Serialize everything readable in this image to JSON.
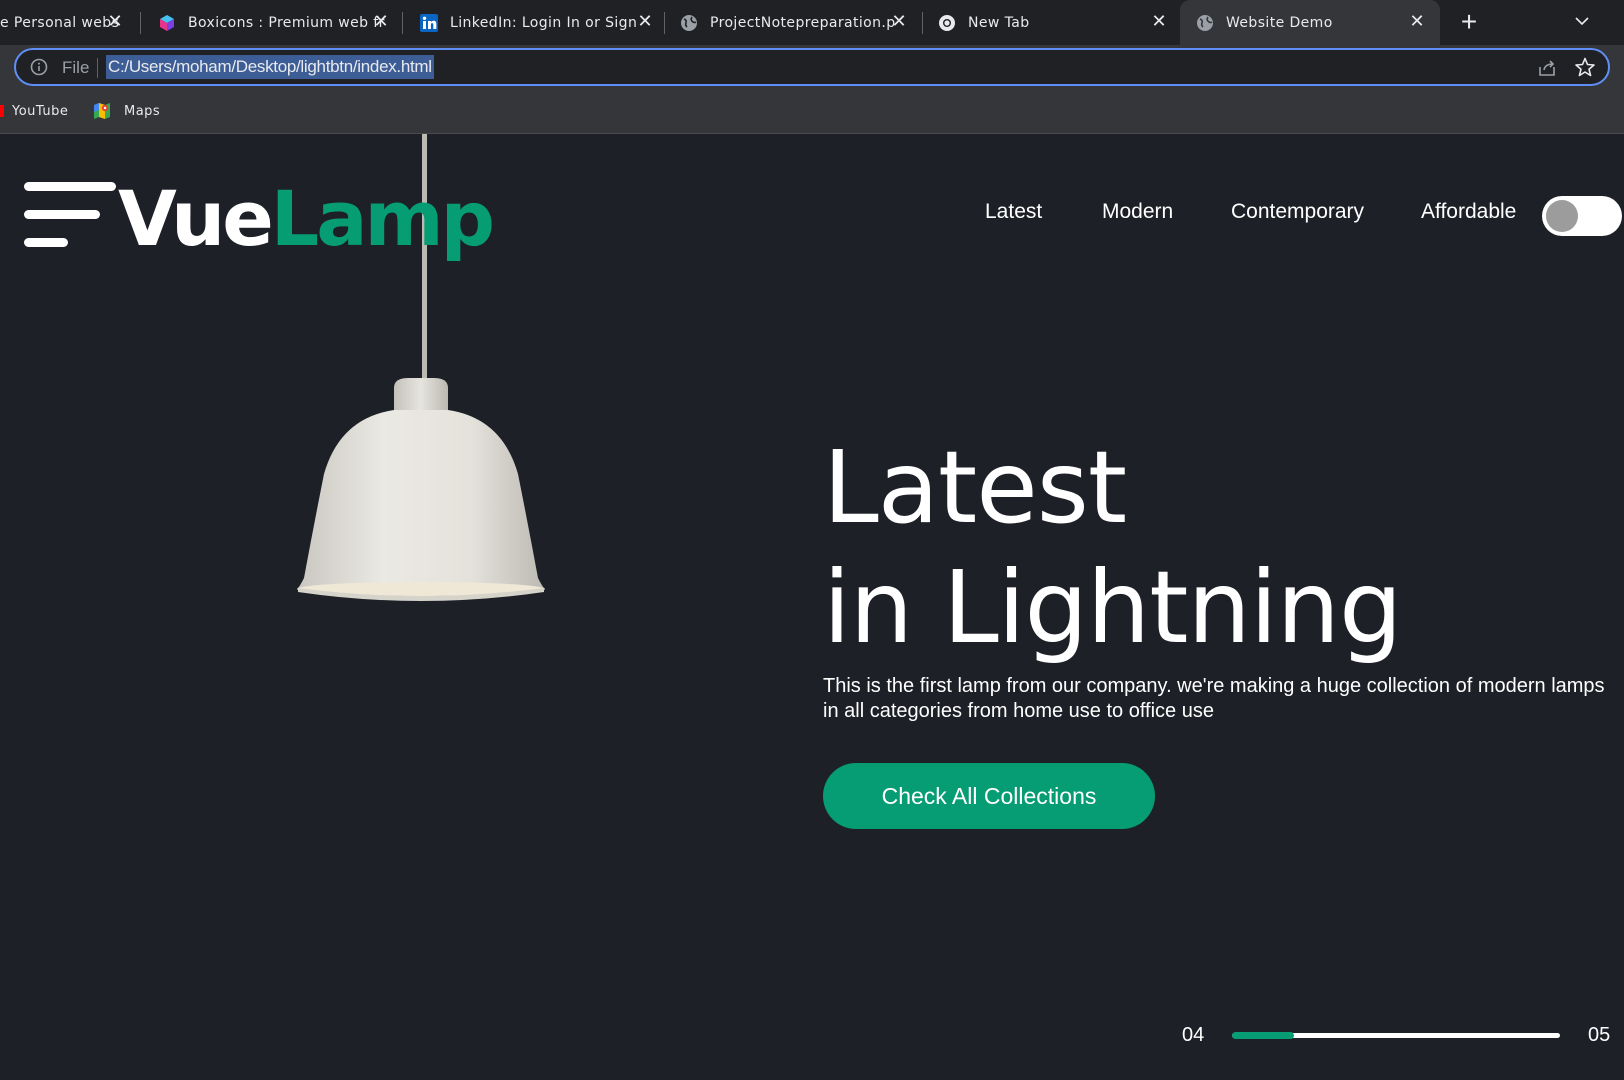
{
  "browser": {
    "tabs": [
      {
        "label": "e Personal webs",
        "icon": "globe-icon",
        "active": false
      },
      {
        "label": "Boxicons : Premium web fr",
        "icon": "boxicons-icon",
        "active": false
      },
      {
        "label": "LinkedIn: Login In or Sign",
        "icon": "linkedin-icon",
        "active": false
      },
      {
        "label": "ProjectNotepreparation.p",
        "icon": "globe-icon",
        "active": false
      },
      {
        "label": "New Tab",
        "icon": "chrome-icon",
        "active": false
      },
      {
        "label": "Website Demo",
        "icon": "globe-icon",
        "active": true
      }
    ],
    "new_tab_glyph": "+",
    "close_glyph": "✕",
    "address": {
      "scheme_label": "File",
      "url": "C:/Users/moham/Desktop/lightbtn/index.html"
    },
    "bookmarks": [
      {
        "label": "YouTube",
        "icon": "youtube-icon"
      },
      {
        "label": "Maps",
        "icon": "maps-icon"
      }
    ]
  },
  "site": {
    "brand_part1": "Vue",
    "brand_part2": "Lamp",
    "nav": [
      "Latest",
      "Modern",
      "Contemporary",
      "Affordable"
    ],
    "dark_mode_toggle_on": false,
    "hero": {
      "title_line1": "Latest",
      "title_line2": "in Lightning",
      "description": "This is the first lamp from our company. we're making a huge collection of modern lamps in all categories from home use to office use",
      "cta_label": "Check All Collections"
    },
    "pager": {
      "current": "04",
      "total": "05",
      "progress_fraction": 0.19
    }
  },
  "colors": {
    "accent": "#069c74",
    "background": "#1e2028",
    "focus_ring": "#5f8ef5"
  }
}
